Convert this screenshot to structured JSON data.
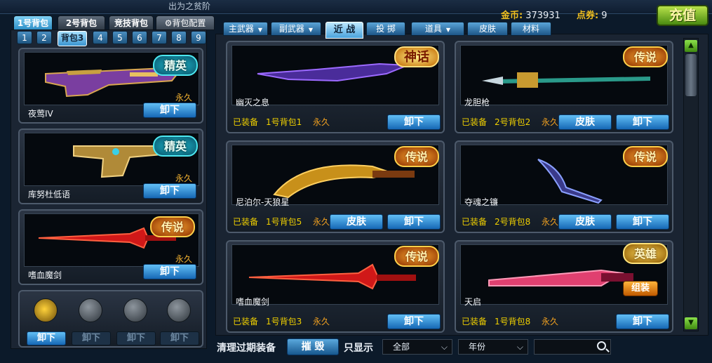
{
  "window": {
    "title_fragment": "出为之贫阶"
  },
  "currency": {
    "gold_label": "金币:",
    "gold_value": "373931",
    "points_label": "点券:",
    "points_value": "9",
    "recharge_label": "充值"
  },
  "left": {
    "pack_tabs": [
      {
        "label": "1号背包"
      },
      {
        "label": "2号背包"
      },
      {
        "label": "竞技背包"
      },
      {
        "label": "背包配置"
      }
    ],
    "slot_tabs": [
      "1",
      "2",
      "背包3",
      "4",
      "5",
      "6",
      "7",
      "8",
      "9"
    ],
    "items": [
      {
        "name": "夜莺IV",
        "duration": "永久",
        "badge": "精英",
        "button": "卸下"
      },
      {
        "name": "库努杜低语",
        "duration": "永久",
        "badge": "精英",
        "button": "卸下"
      },
      {
        "name": "嗜血魔剑",
        "duration": "永久",
        "badge": "传说",
        "button": "卸下"
      }
    ],
    "grenades": {
      "buttons": [
        "卸下",
        "卸下",
        "卸下",
        "卸下"
      ]
    }
  },
  "right": {
    "categories": [
      {
        "label": "主武器"
      },
      {
        "label": "副武器"
      },
      {
        "label": "近 战"
      },
      {
        "label": "投 掷"
      },
      {
        "label": "道具"
      },
      {
        "label": "皮肤"
      },
      {
        "label": "材料"
      }
    ],
    "cards": [
      {
        "name": "幽灭之息",
        "status": "已装备",
        "bag": "1号背包1",
        "duration": "永久",
        "badge": "神话",
        "skin": "",
        "button": "卸下",
        "extra": ""
      },
      {
        "name": "龙胆枪",
        "status": "已装备",
        "bag": "2号背包2",
        "duration": "永久",
        "badge": "传说",
        "skin": "皮肤",
        "button": "卸下",
        "extra": ""
      },
      {
        "name": "尼泊尔-天狼星",
        "status": "已装备",
        "bag": "1号背包5",
        "duration": "永久",
        "badge": "传说",
        "skin": "皮肤",
        "button": "卸下",
        "extra": ""
      },
      {
        "name": "夺魂之镰",
        "status": "已装备",
        "bag": "2号背包8",
        "duration": "永久",
        "badge": "传说",
        "skin": "皮肤",
        "button": "卸下",
        "extra": ""
      },
      {
        "name": "嗜血魔剑",
        "status": "已装备",
        "bag": "1号背包3",
        "duration": "永久",
        "badge": "传说",
        "skin": "",
        "button": "卸下",
        "extra": ""
      },
      {
        "name": "天启",
        "status": "已装备",
        "bag": "1号背包8",
        "duration": "永久",
        "badge": "英雄",
        "skin": "",
        "button": "卸下",
        "extra": "组装"
      }
    ]
  },
  "bottom": {
    "clean_label": "清理过期装备",
    "destroy_label": "摧 毁",
    "only_show_label": "只显示",
    "filter_all": "全部",
    "filter_year": "年份",
    "search_placeholder": ""
  },
  "colors": {
    "accent_blue": "#2e8fc6",
    "gold": "#f0c020",
    "legend_orange": "#ff8a1a",
    "elite_cyan": "#1ec4d8"
  }
}
